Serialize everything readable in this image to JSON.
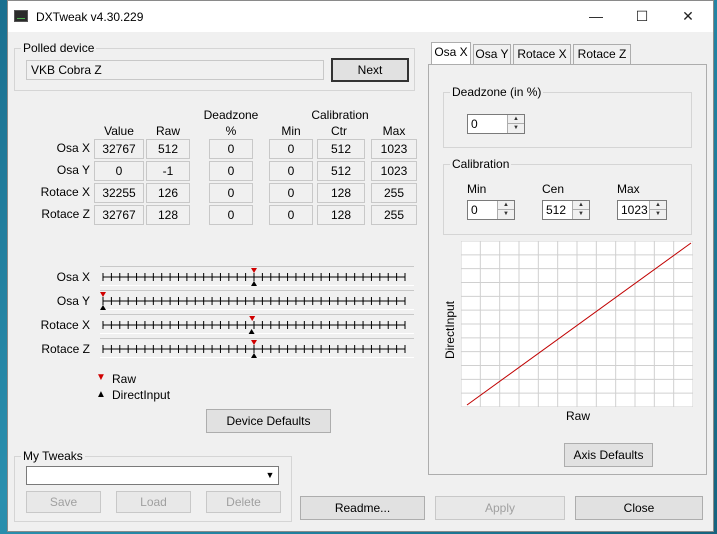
{
  "window": {
    "title": "DXTweak v4.30.229",
    "minimize": "—",
    "maximize": "☐",
    "close": "✕"
  },
  "polled": {
    "label": "Polled device",
    "device": "VKB Cobra Z",
    "next": "Next"
  },
  "table": {
    "headers": {
      "value": "Value",
      "raw": "Raw",
      "deadzone": "Deadzone",
      "deadzone_unit": "%",
      "calibration": "Calibration",
      "min": "Min",
      "ctr": "Ctr",
      "max": "Max"
    },
    "rows": [
      {
        "axis": "Osa X",
        "value": "32767",
        "raw": "512",
        "deadzone": "0",
        "min": "0",
        "ctr": "512",
        "max": "1023"
      },
      {
        "axis": "Osa Y",
        "value": "0",
        "raw": "-1",
        "deadzone": "0",
        "min": "0",
        "ctr": "512",
        "max": "1023"
      },
      {
        "axis": "Rotace X",
        "value": "32255",
        "raw": "126",
        "deadzone": "0",
        "min": "0",
        "ctr": "128",
        "max": "255"
      },
      {
        "axis": "Rotace Z",
        "value": "32767",
        "raw": "128",
        "deadzone": "0",
        "min": "0",
        "ctr": "128",
        "max": "255"
      }
    ]
  },
  "sliders": [
    {
      "axis": "Osa X",
      "raw_fraction": 0.5,
      "di_fraction": 0.5
    },
    {
      "axis": "Osa Y",
      "raw_fraction": 0.0,
      "di_fraction": 0.0
    },
    {
      "axis": "Rotace X",
      "raw_fraction": 0.494,
      "di_fraction": 0.492
    },
    {
      "axis": "Rotace Z",
      "raw_fraction": 0.5,
      "di_fraction": 0.5
    }
  ],
  "legend": {
    "raw": "Raw",
    "direct": "DirectInput",
    "raw_color": "#d00000",
    "direct_color": "#000000"
  },
  "device_defaults": "Device Defaults",
  "tweaks": {
    "label": "My Tweaks",
    "value": "",
    "save": "Save",
    "load": "Load",
    "delete": "Delete"
  },
  "bottom": {
    "readme": "Readme...",
    "apply": "Apply",
    "close": "Close"
  },
  "tabs": [
    "Osa X",
    "Osa Y",
    "Rotace X",
    "Rotace Z"
  ],
  "active_tab": 0,
  "right": {
    "deadzone_label": "Deadzone (in %)",
    "deadzone_value": "0",
    "calibration_label": "Calibration",
    "min_label": "Min",
    "cen_label": "Cen",
    "max_label": "Max",
    "min_value": "0",
    "cen_value": "512",
    "max_value": "1023",
    "graph_xlabel": "Raw",
    "graph_ylabel": "DirectInput",
    "axis_defaults": "Axis Defaults",
    "line_color": "#c00000"
  }
}
